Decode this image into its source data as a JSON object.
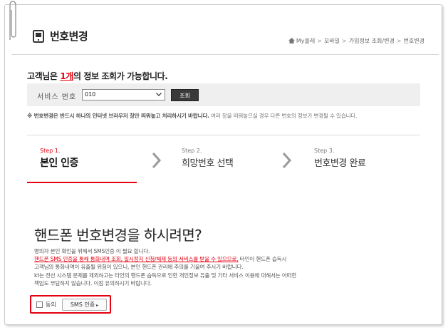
{
  "header": {
    "title": "번호변경",
    "breadcrumb": [
      "My올레",
      "모바일",
      "가입정보 조회/변경",
      "번호변경"
    ]
  },
  "info": {
    "prefix": "고객님은 ",
    "count": "1개",
    "suffix": "의 정보 조회가 가능합니다."
  },
  "service": {
    "label": "서비스 번호",
    "selected": "010",
    "lookup_label": "조회"
  },
  "notice": {
    "bold": "※ 번호변경은 반드시 하나의 인터넷 브라우저 창만 띄워놓고 처리하시기 바랍니다.",
    "normal": " 여러 창을 띄워놓으실 경우 다른 번호의 정보가 변경될 수 있습니다."
  },
  "steps": [
    {
      "num": "Step 1.",
      "name": "본인 인증",
      "active": true
    },
    {
      "num": "Step 2.",
      "name": "희망번호 선택",
      "active": false
    },
    {
      "num": "Step 3.",
      "name": "번호변경 완료",
      "active": false
    }
  ],
  "main": {
    "heading": "핸드폰 번호변경을 하시려면?",
    "line1": "명의자 본인 확인을 위해서 SMS인증 이 필요 합니다.",
    "line2_red": "핸드폰 SMS 인증을 통해 통화내역 조회, 일시정지 신청/해제 등의 서비스를 받을 수 있으므로,",
    "line2_rest": " 타인이 핸드폰 습득시",
    "line3": "고객님의 통화내역이 유출될 위험이 있으니, 본인 핸드폰 관리에 주의를 기울여 주시기 바랍니다.",
    "line4": "kt는 전산 시스템 문제를 제외하고는 타인의 핸드폰 습득으로 인한 개인정보 유출 및 기타 서비스 이용에 대해서는 어떠한",
    "line5": "책임도 부담하지 않습니다. 이점 유의하시기 바랍니다."
  },
  "agree": {
    "label": "동의",
    "sms_button": "SMS 인증"
  },
  "colors": {
    "accent": "#e60012",
    "bar_bg": "#efefef",
    "button_dark": "#3a3a3a"
  }
}
